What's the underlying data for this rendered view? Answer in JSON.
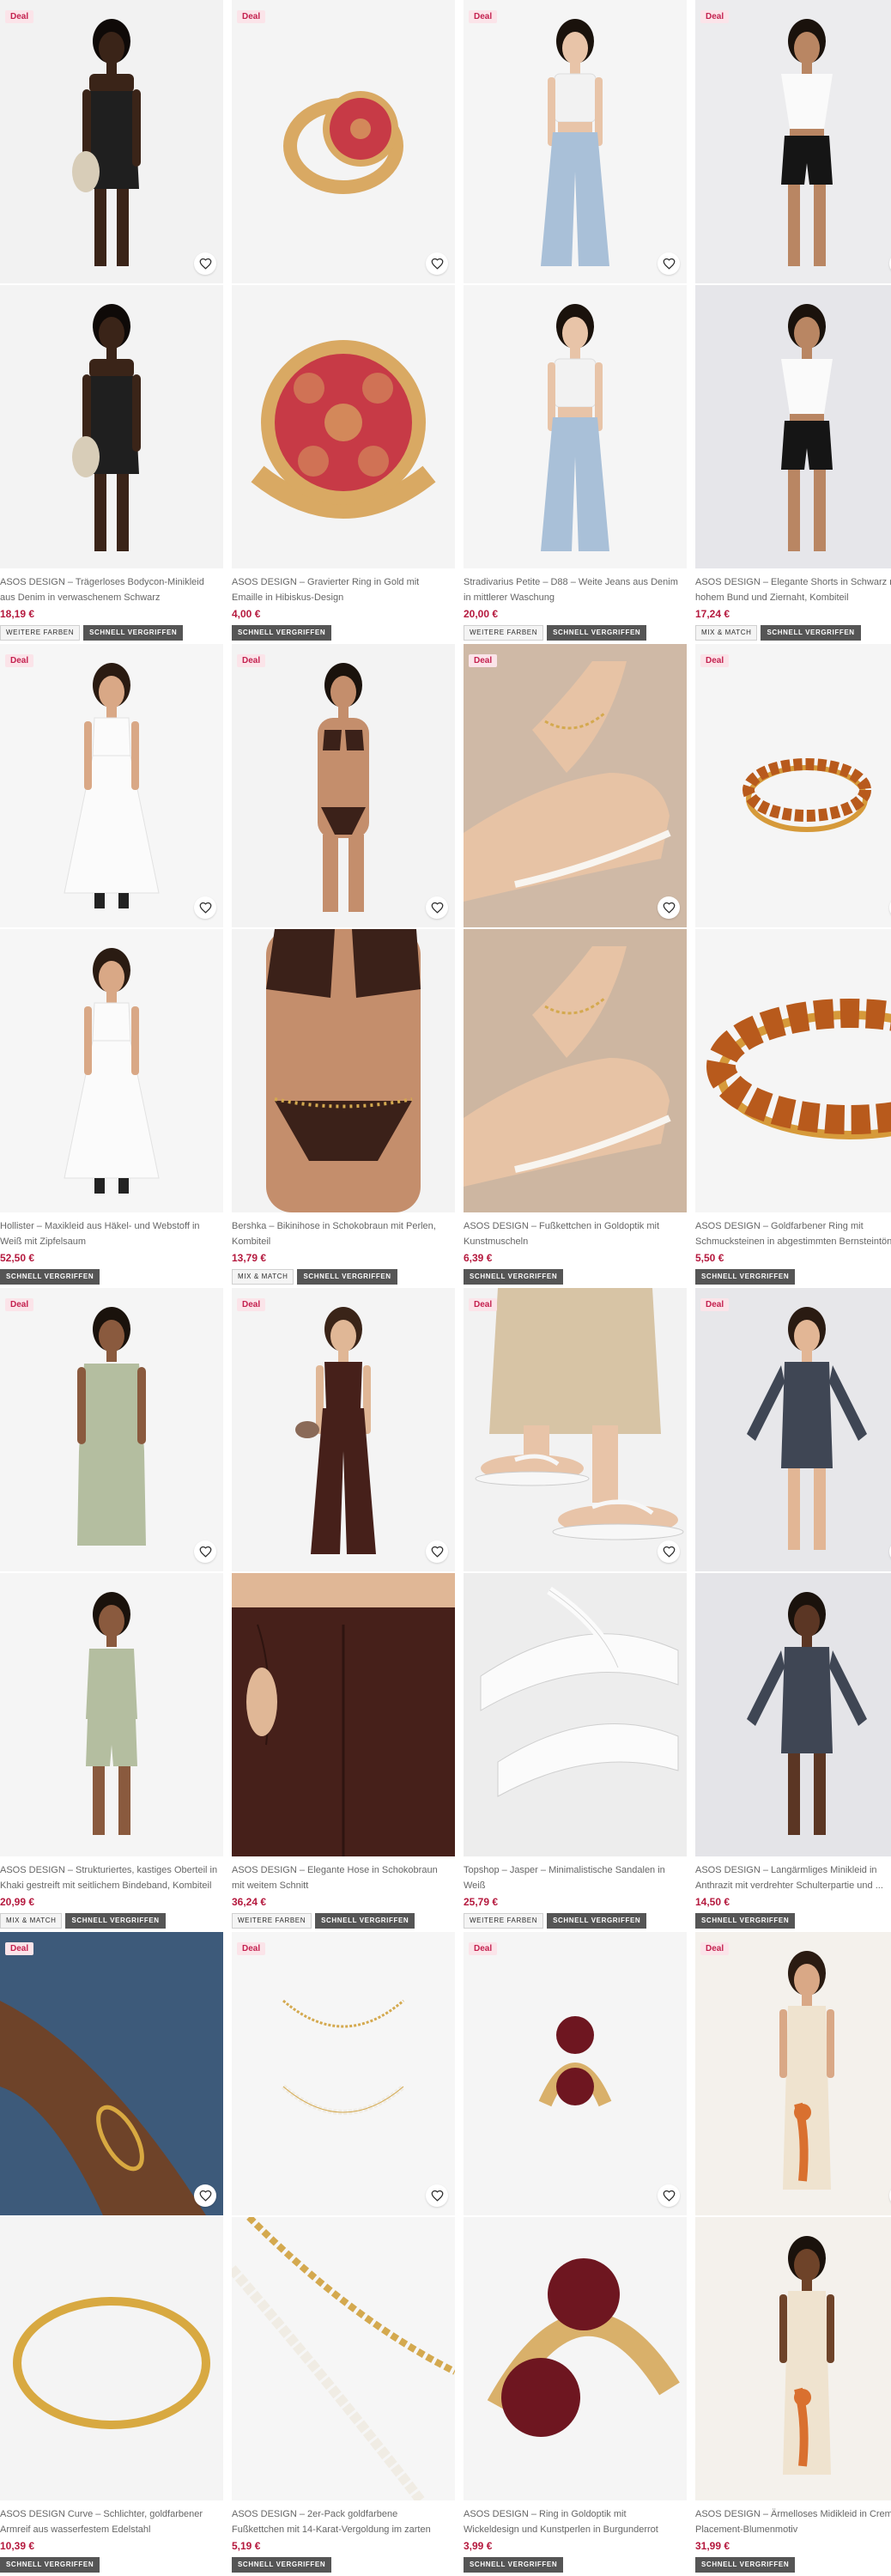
{
  "colors": {
    "deal_badge_bg": "#fbe4e9",
    "deal_badge_text": "#c4214f",
    "price": "#b5193e",
    "quick_buy_tag_bg": "#555555"
  },
  "products": [
    {
      "id": "p1",
      "deal": "Deal",
      "description": "ASOS DESIGN – Trägerloses Bodycon-Minikleid aus Denim in verwaschenem Schwarz",
      "price": "18,19 €",
      "tags": [
        {
          "label": "WEITERE FARBEN",
          "dark": false
        },
        {
          "label": "SCHNELL VERGRIFFEN",
          "dark": true
        }
      ],
      "img_top": {
        "bg": "#f2f2f2",
        "kind": "dress",
        "main": "#1f1f1f",
        "skin": "#3a2418",
        "hair": "#0f0a08"
      },
      "img_bot": {
        "bg": "#f3f3f3",
        "kind": "dress",
        "main": "#1f1f1f",
        "skin": "#3a2418",
        "hair": "#0f0a08"
      }
    },
    {
      "id": "p2",
      "deal": "Deal",
      "description": "ASOS DESIGN – Gravierter Ring in Gold mit Emaille in Hibiskus-Design",
      "price": "4,00 €",
      "tags": [
        {
          "label": "SCHNELL VERGRIFFEN",
          "dark": true
        }
      ],
      "img_top": {
        "bg": "#f4f4f4",
        "kind": "ring",
        "main": "#d9a963",
        "accent": "#c73a46"
      },
      "img_bot": {
        "bg": "#f4f4f4",
        "kind": "ringbig",
        "main": "#d9a963",
        "accent": "#c73a46"
      }
    },
    {
      "id": "p3",
      "deal": "Deal",
      "description": "Stradivarius Petite – D88 – Weite Jeans aus Denim in mittlerer Waschung",
      "price": "20,00 €",
      "tags": [
        {
          "label": "WEITERE FARBEN",
          "dark": false
        },
        {
          "label": "SCHNELL VERGRIFFEN",
          "dark": true
        }
      ],
      "img_top": {
        "bg": "#f5f5f5",
        "kind": "jeans",
        "main": "#a9c0d8",
        "top": "#f2f2f2",
        "skin": "#e8c4a8",
        "hair": "#1a120c"
      },
      "img_bot": {
        "bg": "#f5f5f5",
        "kind": "jeans",
        "main": "#a9c0d8",
        "top": "#f2f2f2",
        "skin": "#e8c4a8",
        "hair": "#1a120c"
      }
    },
    {
      "id": "p4",
      "deal": "Deal",
      "description": "ASOS DESIGN – Elegante Shorts in Schwarz mit hohem Bund und Ziernaht, Kombiteil",
      "price": "17,24 €",
      "tags": [
        {
          "label": "MIX & MATCH",
          "dark": false
        },
        {
          "label": "SCHNELL VERGRIFFEN",
          "dark": true
        }
      ],
      "img_top": {
        "bg": "#ececee",
        "kind": "shorts",
        "main": "#151515",
        "top": "#fafafa",
        "skin": "#b98663",
        "hair": "#1a120c"
      },
      "img_bot": {
        "bg": "#e6e6ea",
        "kind": "shorts",
        "main": "#151515",
        "top": "#fafafa",
        "skin": "#b98663",
        "hair": "#1a120c"
      }
    },
    {
      "id": "p5",
      "deal": "Deal",
      "description": "Hollister – Maxikleid aus Häkel- und Webstoff in Weiß mit Zipfelsaum",
      "price": "52,50 €",
      "tags": [
        {
          "label": "SCHNELL VERGRIFFEN",
          "dark": true
        }
      ],
      "img_top": {
        "bg": "#f6f6f6",
        "kind": "maxi",
        "main": "#fbfbfb",
        "skin": "#d9a886",
        "hair": "#2a1b12"
      },
      "img_bot": {
        "bg": "#f6f6f6",
        "kind": "maxi",
        "main": "#fbfbfb",
        "skin": "#d9a886",
        "hair": "#2a1b12"
      }
    },
    {
      "id": "p6",
      "deal": "Deal",
      "description": "Bershka – Bikinihose in Schokobraun mit Perlen, Kombiteil",
      "price": "13,79 €",
      "tags": [
        {
          "label": "MIX & MATCH",
          "dark": false
        },
        {
          "label": "SCHNELL VERGRIFFEN",
          "dark": true
        }
      ],
      "img_top": {
        "bg": "#f3f3f3",
        "kind": "bikini",
        "main": "#3b2119",
        "skin": "#c48e6c",
        "hair": "#1a120c"
      },
      "img_bot": {
        "bg": "#f3f3f3",
        "kind": "bikiniclose",
        "main": "#3b2119",
        "skin": "#c48e6c",
        "hair": "#1a120c"
      }
    },
    {
      "id": "p7",
      "deal": "Deal",
      "description": "ASOS DESIGN – Fußkettchen in Goldoptik mit Kunstmuscheln",
      "price": "6,39 €",
      "tags": [
        {
          "label": "SCHNELL VERGRIFFEN",
          "dark": true
        }
      ],
      "img_top": {
        "bg": "#cfb9a6",
        "kind": "foot",
        "main": "#d4a94f",
        "skin": "#e7c3a5"
      },
      "img_bot": {
        "bg": "#cdb6a1",
        "kind": "foot",
        "main": "#d4a94f",
        "skin": "#e7c3a5"
      }
    },
    {
      "id": "p8",
      "deal": "Deal",
      "description": "ASOS DESIGN – Goldfarbener Ring mit Schmucksteinen in abgestimmten Bernsteintönen",
      "price": "5,50 €",
      "tags": [
        {
          "label": "SCHNELL VERGRIFFEN",
          "dark": true
        }
      ],
      "img_top": {
        "bg": "#f5f5f5",
        "kind": "band",
        "main": "#d69a3a",
        "accent": "#b85a1c"
      },
      "img_bot": {
        "bg": "#f5f5f5",
        "kind": "bandbig",
        "main": "#d69a3a",
        "accent": "#b85a1c"
      }
    },
    {
      "id": "p9",
      "deal": "Deal",
      "description": "ASOS DESIGN – Strukturiertes, kastiges Oberteil in Khaki gestreift mit seitlichem Bindeband, Kombiteil",
      "price": "20,99 €",
      "tags": [
        {
          "label": "MIX & MATCH",
          "dark": false
        },
        {
          "label": "SCHNELL VERGRIFFEN",
          "dark": true
        }
      ],
      "img_top": {
        "bg": "#f5f5f5",
        "kind": "top",
        "main": "#b4bea0",
        "skin": "#8a5a3e",
        "hair": "#1a120c"
      },
      "img_bot": {
        "bg": "#f5f5f5",
        "kind": "set",
        "main": "#b4bea0",
        "skin": "#8a5a3e",
        "hair": "#1a120c"
      }
    },
    {
      "id": "p10",
      "deal": "Deal",
      "description": "ASOS DESIGN – Elegante Hose in Schokobraun mit weitem Schnitt",
      "price": "36,24 €",
      "tags": [
        {
          "label": "WEITERE FARBEN",
          "dark": false
        },
        {
          "label": "SCHNELL VERGRIFFEN",
          "dark": true
        }
      ],
      "img_top": {
        "bg": "#f4f4f4",
        "kind": "trousers",
        "main": "#46201a",
        "skin": "#e0b796",
        "hair": "#3a2418"
      },
      "img_bot": {
        "bg": "#f0f0f0",
        "kind": "trousersclose",
        "main": "#46201a",
        "skin": "#e0b796"
      }
    },
    {
      "id": "p11",
      "deal": "Deal",
      "description": "Topshop – Jasper – Minimalistische Sandalen in Weiß",
      "price": "25,79 €",
      "tags": [
        {
          "label": "WEITERE FARBEN",
          "dark": false
        },
        {
          "label": "SCHNELL VERGRIFFEN",
          "dark": true
        }
      ],
      "img_top": {
        "bg": "#f2f2f2",
        "kind": "sandal",
        "main": "#f7f7f7",
        "skin": "#e8c4a8",
        "skirt": "#d7c4a5"
      },
      "img_bot": {
        "bg": "#ededed",
        "kind": "sandalflat",
        "main": "#fbfbfb"
      }
    },
    {
      "id": "p12",
      "deal": "Deal",
      "description": "ASOS DESIGN – Langärmliges Minikleid in Anthrazit mit verdrehter Schulterpartie und ...",
      "price": "14,50 €",
      "tags": [
        {
          "label": "SCHNELL VERGRIFFEN",
          "dark": true
        }
      ],
      "img_top": {
        "bg": "#e7e7ea",
        "kind": "minidress",
        "main": "#3f4654",
        "skin": "#e2b695",
        "hair": "#2a1b12"
      },
      "img_bot": {
        "bg": "#e4e4e8",
        "kind": "minidress",
        "main": "#3f4654",
        "skin": "#5b3624",
        "hair": "#1a120c"
      }
    },
    {
      "id": "p13",
      "deal": "Deal",
      "description": "ASOS DESIGN Curve – Schlichter, goldfarbener Armreif aus wasserfestem Edelstahl",
      "price": "10,39 €",
      "tags": [
        {
          "label": "SCHNELL VERGRIFFEN",
          "dark": true
        }
      ],
      "img_top": {
        "bg": "#3d5a7a",
        "kind": "arm",
        "main": "#d8a941",
        "skin": "#6e4329"
      },
      "img_bot": {
        "bg": "#f4f4f4",
        "kind": "bangle",
        "main": "#d8a941"
      }
    },
    {
      "id": "p14",
      "deal": "Deal",
      "description": "ASOS DESIGN – 2er-Pack goldfarbene Fußkettchen mit 14-Karat-Vergoldung im zarten Ketten- und...",
      "price": "5,19 €",
      "tags": [
        {
          "label": "SCHNELL VERGRIFFEN",
          "dark": true
        }
      ],
      "img_top": {
        "bg": "#f6f6f6",
        "kind": "chains",
        "main": "#d4a94f",
        "accent": "#f0ece4"
      },
      "img_bot": {
        "bg": "#f6f6f6",
        "kind": "chainsclose",
        "main": "#d4a94f",
        "accent": "#f0ece4"
      }
    },
    {
      "id": "p15",
      "deal": "Deal",
      "description": "ASOS DESIGN – Ring in Goldoptik mit Wickeldesign und Kunstperlen in Burgunderrot",
      "price": "3,99 €",
      "tags": [
        {
          "label": "SCHNELL VERGRIFFEN",
          "dark": true
        }
      ],
      "img_top": {
        "bg": "#f5f5f5",
        "kind": "twinring",
        "main": "#d9b06a",
        "accent": "#6e1620"
      },
      "img_bot": {
        "bg": "#f5f5f5",
        "kind": "twinringbig",
        "main": "#d9b06a",
        "accent": "#6e1620"
      }
    },
    {
      "id": "p16",
      "deal": "Deal",
      "description": "ASOS DESIGN – Ärmelloses Midikleid in Creme mit Placement-Blumenmotiv",
      "price": "31,99 €",
      "tags": [
        {
          "label": "SCHNELL VERGRIFFEN",
          "dark": true
        }
      ],
      "img_top": {
        "bg": "#f4f1ec",
        "kind": "midi",
        "main": "#efe3cf",
        "accent": "#d9702f",
        "skin": "#d9a886",
        "hair": "#2a1b12"
      },
      "img_bot": {
        "bg": "#f4f1ec",
        "kind": "midi",
        "main": "#efe3cf",
        "accent": "#d9702f",
        "skin": "#6e4329",
        "hair": "#1a120c"
      }
    }
  ]
}
